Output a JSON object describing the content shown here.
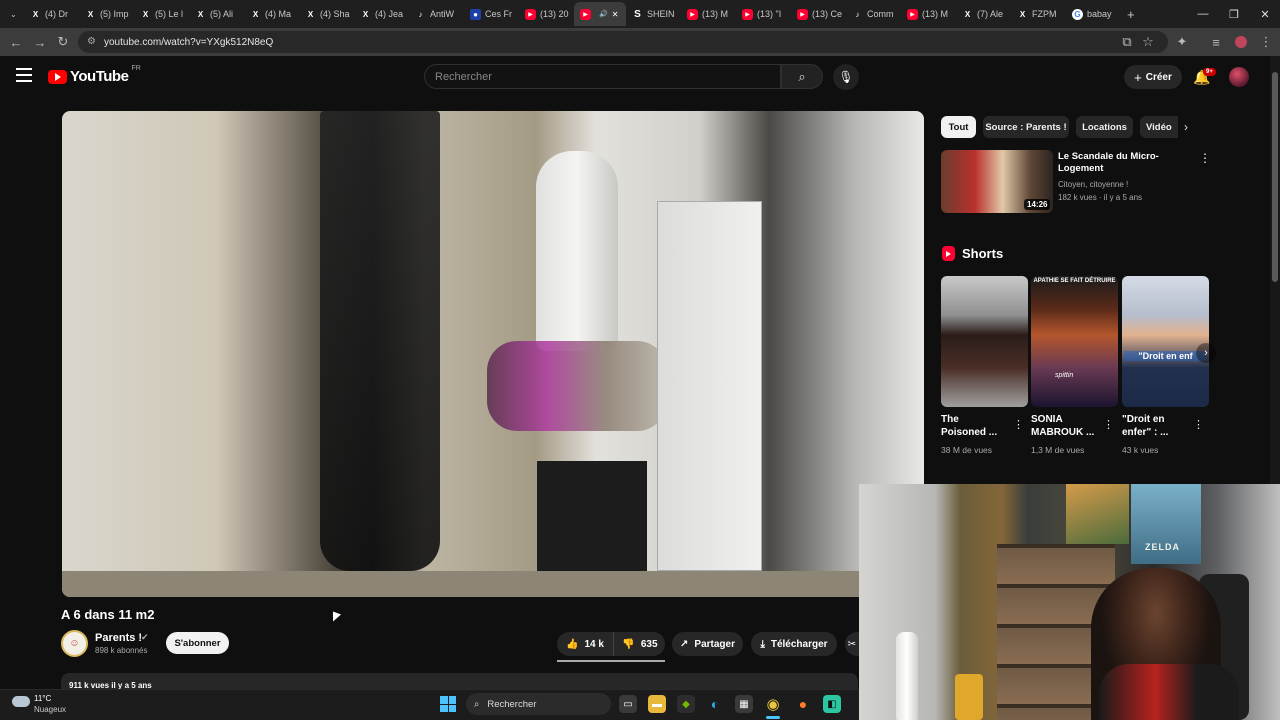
{
  "browser": {
    "tabs": [
      {
        "label": "(4) Dr",
        "icon": "x"
      },
      {
        "label": "(5) Imp",
        "icon": "x"
      },
      {
        "label": "(5) Le l",
        "icon": "x"
      },
      {
        "label": "(5) Ali",
        "icon": "x"
      },
      {
        "label": "(4) Ma",
        "icon": "x"
      },
      {
        "label": "(4) Sha",
        "icon": "x"
      },
      {
        "label": "(4) Jea",
        "icon": "x"
      },
      {
        "label": "AntiW",
        "icon": "tiktok"
      },
      {
        "label": "Ces Fr",
        "icon": "fr"
      },
      {
        "label": "(13) 20",
        "icon": "youtube"
      },
      {
        "label": "",
        "icon": "youtube",
        "active": true
      },
      {
        "label": "SHEIN",
        "icon": "shein"
      },
      {
        "label": "(13) M",
        "icon": "youtube"
      },
      {
        "label": "(13) \"I",
        "icon": "youtube"
      },
      {
        "label": "(13) Ce",
        "icon": "youtube"
      },
      {
        "label": "Comm",
        "icon": "tiktok"
      },
      {
        "label": "(13) M",
        "icon": "youtube"
      },
      {
        "label": "(7) Ale",
        "icon": "x"
      },
      {
        "label": "FZPM",
        "icon": "x"
      },
      {
        "label": "babay",
        "icon": "google"
      }
    ],
    "url": "youtube.com/watch?v=YXgk512N8eQ"
  },
  "youtube": {
    "logo_word": "YouTube",
    "logo_country": "FR",
    "search_placeholder": "Rechercher",
    "create_label": "Créer",
    "notif_badge": "9+"
  },
  "video": {
    "title": "A 6 dans 11 m2",
    "channel": "Parents !",
    "subscribers": "898 k abonnés",
    "subscribe_label": "S'abonner",
    "likes": "14 k",
    "dislikes": "635",
    "share_label": "Partager",
    "download_label": "Télécharger",
    "description_preview": "911 k vues  il y a 5 ans"
  },
  "sidebar": {
    "chips": [
      "Tout",
      "Source : Parents !",
      "Locations",
      "Vidéo"
    ],
    "recommendation": {
      "title": "Le Scandale du Micro-Logement",
      "channel": "Citoyen, citoyenne !",
      "meta": "182 k vues · il y a 5 ans",
      "duration": "14:26"
    },
    "shorts_heading": "Shorts",
    "shorts": [
      {
        "title_line1": "The",
        "title_line2": "Poisoned ...",
        "views": "38 M de vues"
      },
      {
        "title_line1": "SONIA",
        "title_line2": "MABROUK ...",
        "views": "1,3 M de vues",
        "overlay_top": "APATHIE SE FAIT DÉTRUIRE",
        "overlay_caption": "spittin"
      },
      {
        "title_line1": "\"Droit en",
        "title_line2": "enfer\" : ...",
        "views": "43 k vues",
        "overlay_caption": "\"Droit en enf"
      }
    ]
  },
  "webcam": {
    "poster_text": "ZELDA"
  },
  "taskbar": {
    "weather_temp": "11°C",
    "weather_desc": "Nuageux",
    "search_label": "Rechercher"
  }
}
